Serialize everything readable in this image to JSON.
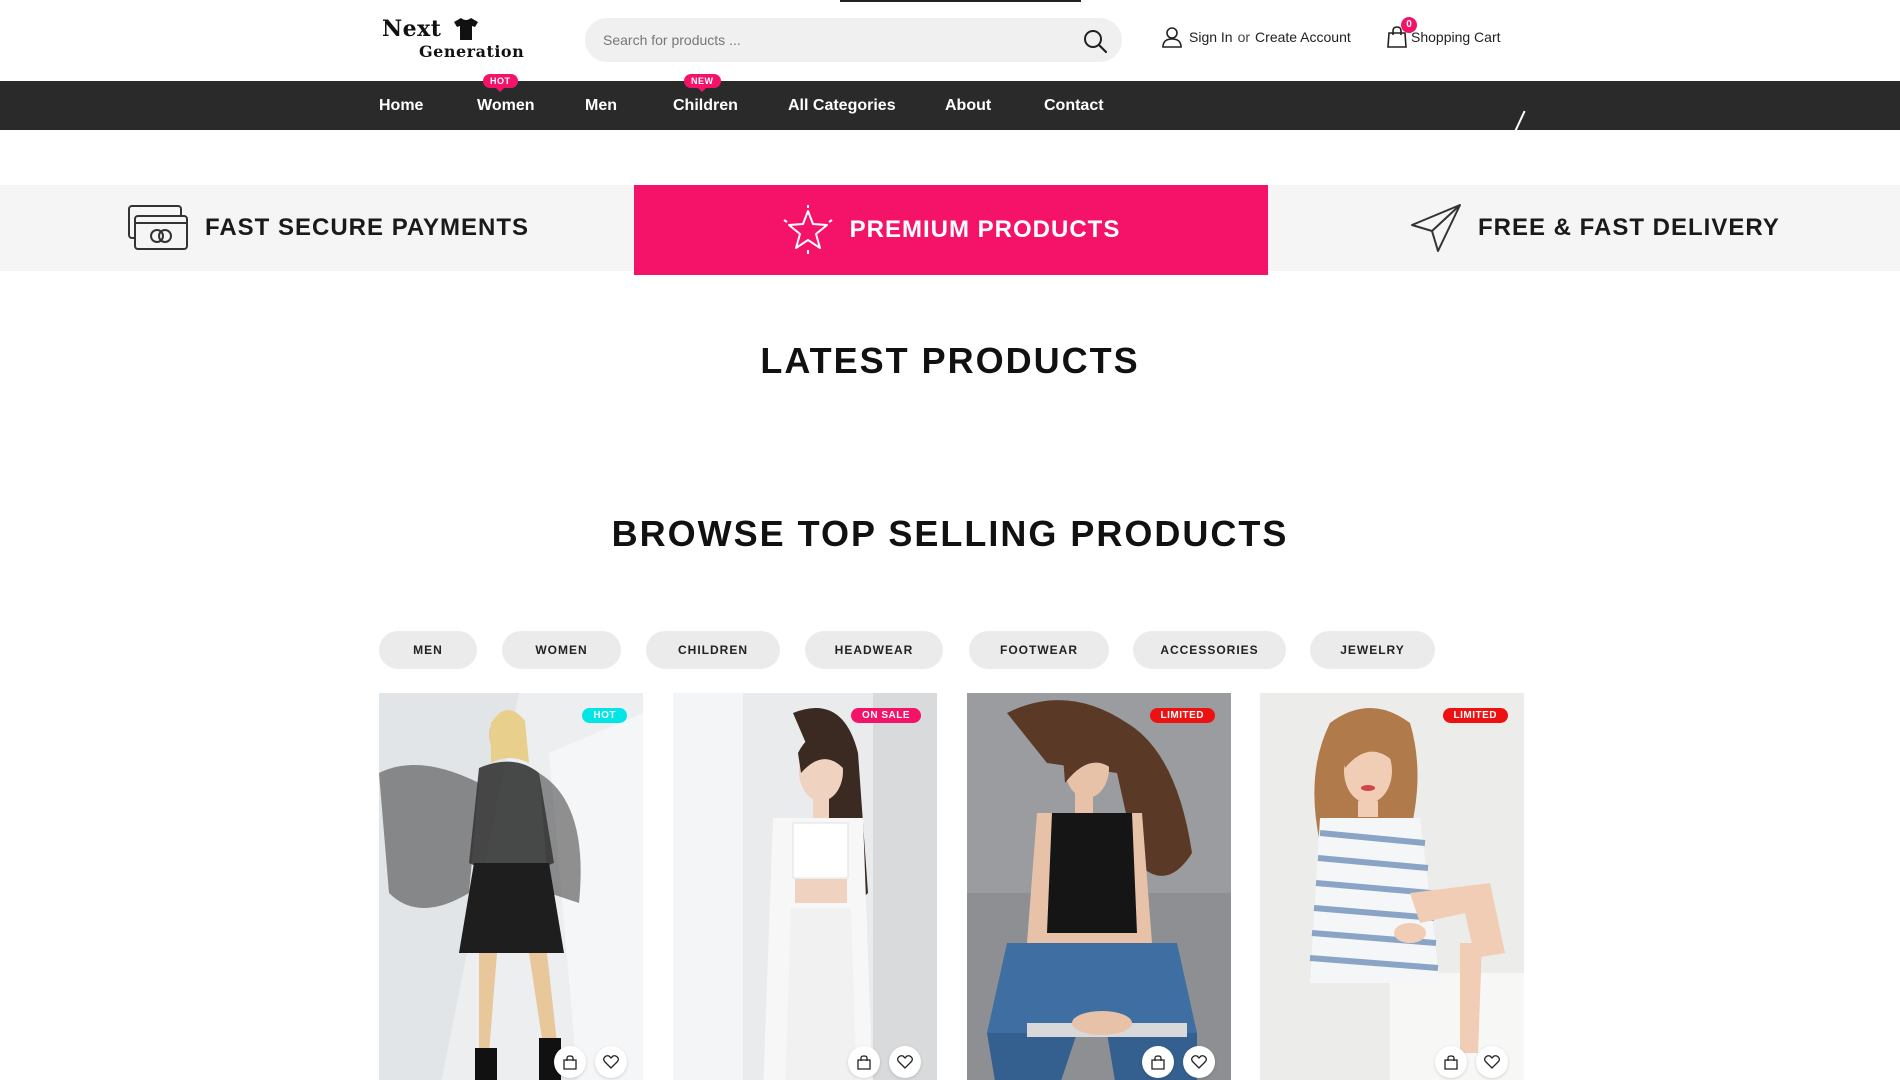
{
  "brand": {
    "line1": "Next",
    "line2": "Generation"
  },
  "search": {
    "placeholder": "Search for products ..."
  },
  "account": {
    "sign_in": "Sign In",
    "or": "or",
    "create": "Create Account"
  },
  "cart": {
    "label": "Shopping Cart",
    "count": "0"
  },
  "nav": {
    "items": [
      {
        "label": "Home"
      },
      {
        "label": "Women",
        "badge": "HOT"
      },
      {
        "label": "Men"
      },
      {
        "label": "Children",
        "badge": "NEW"
      },
      {
        "label": "All Categories"
      },
      {
        "label": "About"
      },
      {
        "label": "Contact"
      }
    ]
  },
  "features": [
    {
      "label": "FAST SECURE PAYMENTS",
      "icon": "payment-card-icon"
    },
    {
      "label": "PREMIUM PRODUCTS",
      "icon": "star-icon"
    },
    {
      "label": "FREE & FAST DELIVERY",
      "icon": "paper-plane-icon"
    }
  ],
  "sections": {
    "latest": "LATEST PRODUCTS",
    "top_selling": "BROWSE TOP SELLING PRODUCTS"
  },
  "filters": [
    "MEN",
    "WOMEN",
    "CHILDREN",
    "HEADWEAR",
    "FOOTWEAR",
    "ACCESSORIES",
    "JEWELRY"
  ],
  "products": [
    {
      "tag": "HOT",
      "tag_color": "#00e5e5"
    },
    {
      "tag": "ON SALE",
      "tag_color": "#f5136a"
    },
    {
      "tag": "LIMITED",
      "tag_color": "#ee1111"
    },
    {
      "tag": "LIMITED",
      "tag_color": "#ee1111"
    }
  ],
  "colors": {
    "accent": "#f5136a",
    "nav_bg": "#2a2a2a",
    "strip_bg": "#f5f5f5"
  }
}
